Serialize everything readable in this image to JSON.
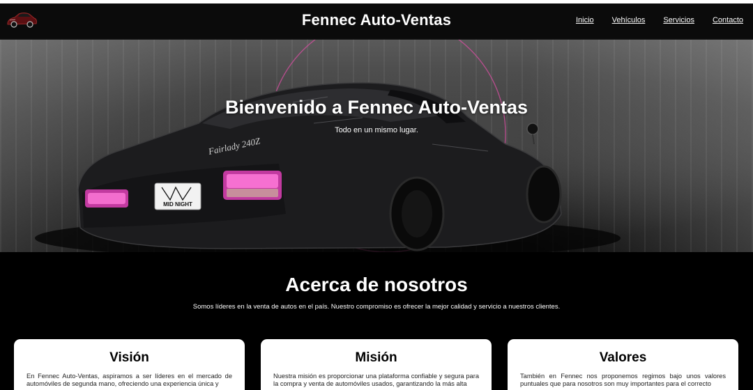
{
  "header": {
    "logo_icon": "sports-car-logo-icon",
    "title": "Fennec Auto-Ventas",
    "nav": [
      {
        "label": "Inicio"
      },
      {
        "label": "Vehículos"
      },
      {
        "label": "Servicios"
      },
      {
        "label": "Contacto"
      }
    ]
  },
  "hero": {
    "title": "Bienvenido a Fennec Auto-Ventas",
    "subtitle": "Todo en un mismo lugar.",
    "plate_text": "MID NIGHT",
    "car_badge": "Fairlady 240Z"
  },
  "about": {
    "title": "Acerca de nosotros",
    "text": "Somos líderes en la venta de autos en el país. Nuestro compromiso es ofrecer la mejor calidad y servicio a nuestros clientes."
  },
  "cards": [
    {
      "title": "Visión",
      "text": "En Fennec Auto-Ventas, aspiramos a ser líderes en el mercado de automóviles de segunda mano, ofreciendo una experiencia única y"
    },
    {
      "title": "Misión",
      "text": "Nuestra misión es proporcionar una plataforma confiable y segura para la compra y venta de automóviles usados, garantizando la más alta"
    },
    {
      "title": "Valores",
      "text": "También en Fennec nos proponemos regimos bajo unos valores puntuales que para nosotros son muy importantes para el correcto"
    }
  ],
  "colors": {
    "header_bg": "#0b0b0b",
    "accent_pink": "#d64fa0",
    "card_bg": "#ffffff"
  }
}
